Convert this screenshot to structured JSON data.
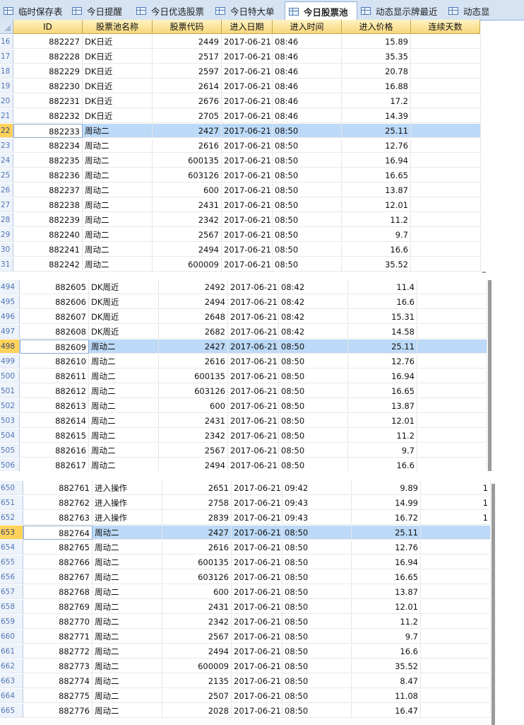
{
  "tabs": [
    {
      "label": "临时保存表",
      "icon": "table-icon",
      "active": false
    },
    {
      "label": "今日提醒",
      "icon": "table-icon",
      "active": false
    },
    {
      "label": "今日优选股票",
      "icon": "table-icon",
      "active": false
    },
    {
      "label": "今日特大单",
      "icon": "table-icon",
      "active": false
    },
    {
      "label": "今日股票池",
      "icon": "table-icon",
      "active": true
    },
    {
      "label": "动态显示牌最近",
      "icon": "table-icon",
      "active": false
    },
    {
      "label": "动态显",
      "icon": "table-icon",
      "active": false
    }
  ],
  "columns": [
    "ID",
    "股票池名称",
    "股票代码",
    "进入日期",
    "进入时间",
    "进入价格",
    "连续天数"
  ],
  "colors": {
    "selected_row": "#bcd9f7",
    "header": "#f8d77b",
    "row_number": "#4f76b5",
    "selected_rownum": "#ffd259"
  },
  "panels": [
    {
      "selected_row": "22",
      "rows": [
        [
          "16",
          "882227",
          "DK日近",
          "2449",
          "2017-06-21",
          "08:46",
          "15.89",
          ""
        ],
        [
          "17",
          "882228",
          "DK日近",
          "2517",
          "2017-06-21",
          "08:46",
          "35.35",
          ""
        ],
        [
          "18",
          "882229",
          "DK日近",
          "2597",
          "2017-06-21",
          "08:46",
          "20.78",
          ""
        ],
        [
          "19",
          "882230",
          "DK日近",
          "2614",
          "2017-06-21",
          "08:46",
          "16.88",
          ""
        ],
        [
          "20",
          "882231",
          "DK日近",
          "2676",
          "2017-06-21",
          "08:46",
          "17.2",
          ""
        ],
        [
          "21",
          "882232",
          "DK日近",
          "2705",
          "2017-06-21",
          "08:46",
          "14.39",
          ""
        ],
        [
          "22",
          "882233",
          "周动二",
          "2427",
          "2017-06-21",
          "08:50",
          "25.11",
          ""
        ],
        [
          "23",
          "882234",
          "周动二",
          "2616",
          "2017-06-21",
          "08:50",
          "12.76",
          ""
        ],
        [
          "24",
          "882235",
          "周动二",
          "600135",
          "2017-06-21",
          "08:50",
          "16.94",
          ""
        ],
        [
          "25",
          "882236",
          "周动二",
          "603126",
          "2017-06-21",
          "08:50",
          "16.65",
          ""
        ],
        [
          "26",
          "882237",
          "周动二",
          "600",
          "2017-06-21",
          "08:50",
          "13.87",
          ""
        ],
        [
          "27",
          "882238",
          "周动二",
          "2431",
          "2017-06-21",
          "08:50",
          "12.01",
          ""
        ],
        [
          "28",
          "882239",
          "周动二",
          "2342",
          "2017-06-21",
          "08:50",
          "11.2",
          ""
        ],
        [
          "29",
          "882240",
          "周动二",
          "2567",
          "2017-06-21",
          "08:50",
          "9.7",
          ""
        ],
        [
          "30",
          "882241",
          "周动二",
          "2494",
          "2017-06-21",
          "08:50",
          "16.6",
          ""
        ],
        [
          "31",
          "882242",
          "周动二",
          "600009",
          "2017-06-21",
          "08:50",
          "35.52",
          ""
        ]
      ]
    },
    {
      "selected_row": "498",
      "rows": [
        [
          "494",
          "882605",
          "DK周近",
          "2492",
          "2017-06-21",
          "08:42",
          "11.4",
          ""
        ],
        [
          "495",
          "882606",
          "DK周近",
          "2494",
          "2017-06-21",
          "08:42",
          "16.6",
          ""
        ],
        [
          "496",
          "882607",
          "DK周近",
          "2648",
          "2017-06-21",
          "08:42",
          "15.31",
          ""
        ],
        [
          "497",
          "882608",
          "DK周近",
          "2682",
          "2017-06-21",
          "08:42",
          "14.58",
          ""
        ],
        [
          "498",
          "882609",
          "周动二",
          "2427",
          "2017-06-21",
          "08:50",
          "25.11",
          ""
        ],
        [
          "499",
          "882610",
          "周动二",
          "2616",
          "2017-06-21",
          "08:50",
          "12.76",
          ""
        ],
        [
          "500",
          "882611",
          "周动二",
          "600135",
          "2017-06-21",
          "08:50",
          "16.94",
          ""
        ],
        [
          "501",
          "882612",
          "周动二",
          "603126",
          "2017-06-21",
          "08:50",
          "16.65",
          ""
        ],
        [
          "502",
          "882613",
          "周动二",
          "600",
          "2017-06-21",
          "08:50",
          "13.87",
          ""
        ],
        [
          "503",
          "882614",
          "周动二",
          "2431",
          "2017-06-21",
          "08:50",
          "12.01",
          ""
        ],
        [
          "504",
          "882615",
          "周动二",
          "2342",
          "2017-06-21",
          "08:50",
          "11.2",
          ""
        ],
        [
          "505",
          "882616",
          "周动二",
          "2567",
          "2017-06-21",
          "08:50",
          "9.7",
          ""
        ],
        [
          "506",
          "882617",
          "周动二",
          "2494",
          "2017-06-21",
          "08:50",
          "16.6",
          ""
        ]
      ]
    },
    {
      "selected_row": "653",
      "rows": [
        [
          "650",
          "882761",
          "进入操作",
          "2651",
          "2017-06-21",
          "09:42",
          "9.89",
          "1"
        ],
        [
          "651",
          "882762",
          "进入操作",
          "2758",
          "2017-06-21",
          "09:43",
          "14.99",
          "1"
        ],
        [
          "652",
          "882763",
          "进入操作",
          "2839",
          "2017-06-21",
          "09:43",
          "16.72",
          "1"
        ],
        [
          "653",
          "882764",
          "周动二",
          "2427",
          "2017-06-21",
          "08:50",
          "25.11",
          ""
        ],
        [
          "654",
          "882765",
          "周动二",
          "2616",
          "2017-06-21",
          "08:50",
          "12.76",
          ""
        ],
        [
          "655",
          "882766",
          "周动二",
          "600135",
          "2017-06-21",
          "08:50",
          "16.94",
          ""
        ],
        [
          "656",
          "882767",
          "周动二",
          "603126",
          "2017-06-21",
          "08:50",
          "16.65",
          ""
        ],
        [
          "657",
          "882768",
          "周动二",
          "600",
          "2017-06-21",
          "08:50",
          "13.87",
          ""
        ],
        [
          "658",
          "882769",
          "周动二",
          "2431",
          "2017-06-21",
          "08:50",
          "12.01",
          ""
        ],
        [
          "659",
          "882770",
          "周动二",
          "2342",
          "2017-06-21",
          "08:50",
          "11.2",
          ""
        ],
        [
          "660",
          "882771",
          "周动二",
          "2567",
          "2017-06-21",
          "08:50",
          "9.7",
          ""
        ],
        [
          "661",
          "882772",
          "周动二",
          "2494",
          "2017-06-21",
          "08:50",
          "16.6",
          ""
        ],
        [
          "662",
          "882773",
          "周动二",
          "600009",
          "2017-06-21",
          "08:50",
          "35.52",
          ""
        ],
        [
          "663",
          "882774",
          "周动二",
          "2135",
          "2017-06-21",
          "08:50",
          "8.47",
          ""
        ],
        [
          "664",
          "882775",
          "周动二",
          "2507",
          "2017-06-21",
          "08:50",
          "11.08",
          ""
        ],
        [
          "665",
          "882776",
          "周动二",
          "2028",
          "2017-06-21",
          "08:50",
          "16.47",
          ""
        ]
      ]
    }
  ]
}
